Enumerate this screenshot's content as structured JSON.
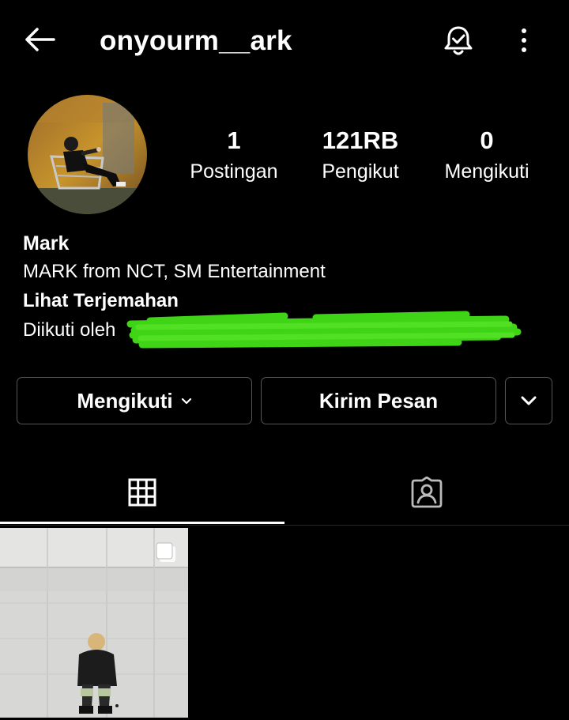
{
  "header": {
    "username": "onyourm__ark",
    "back_icon": "arrow-left-icon",
    "bell_icon": "bell-check-icon",
    "more_icon": "more-vertical-icon"
  },
  "stats": {
    "posts": {
      "value": "1",
      "label": "Postingan"
    },
    "followers": {
      "value": "121RB",
      "label": "Pengikut"
    },
    "following": {
      "value": "0",
      "label": "Mengikuti"
    }
  },
  "bio": {
    "name": "Mark",
    "description": "MARK from NCT, SM Entertainment",
    "translate": "Lihat Terjemahan",
    "followed_by": "Diikuti oleh"
  },
  "actions": {
    "following_label": "Mengikuti",
    "message_label": "Kirim Pesan",
    "more_icon": "chevron-down-icon"
  },
  "tabs": [
    {
      "name": "grid",
      "icon": "grid-icon",
      "active": true
    },
    {
      "name": "tagged",
      "icon": "tagged-person-icon",
      "active": false
    }
  ],
  "colors": {
    "background": "#000000",
    "text": "#ffffff",
    "border": "#555555",
    "redaction": "#3fd416"
  }
}
